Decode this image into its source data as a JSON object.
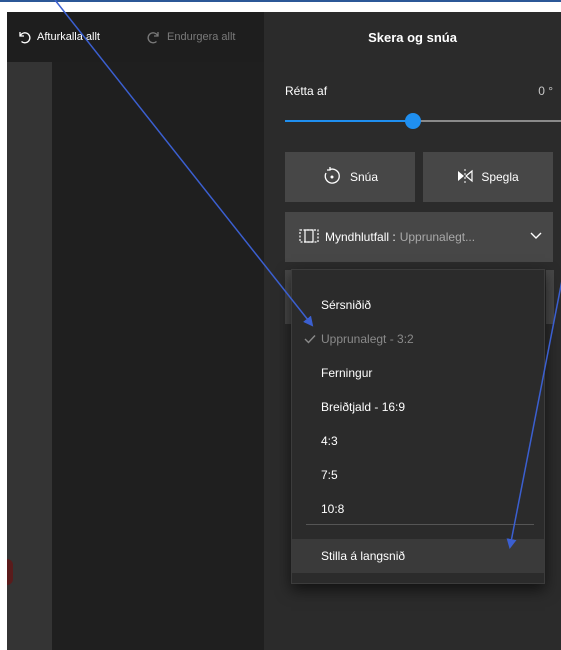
{
  "toolbar": {
    "undo_all_label": "Afturkalla allt",
    "redo_all_label": "Endurgera allt"
  },
  "panel": {
    "title": "Skera og snúa",
    "straighten_label": "Rétta af",
    "straighten_value": "0 °",
    "straighten_level_percent": 46,
    "rotate_label": "Snúa",
    "flip_label": "Spegla",
    "aspect_label": "Myndhlutfall :",
    "aspect_value": "Upprunalegt..."
  },
  "aspect_menu": {
    "items": [
      {
        "label": "Sérsniðið"
      },
      {
        "label": "Upprunalegt - 3:2",
        "selected": true
      },
      {
        "label": "Ferningur"
      },
      {
        "label": "Breiðtjald - 16:9"
      },
      {
        "label": "4:3"
      },
      {
        "label": "7:5"
      },
      {
        "label": "10:8"
      }
    ],
    "landscape_label": "Stilla á langsnið"
  },
  "colors": {
    "accent": "#1f8ff0",
    "annotation_arrow": "#3b5fd0",
    "panel_bg": "#2b2b2b",
    "button_bg": "#474747"
  },
  "icons": [
    "undo-icon",
    "redo-icon",
    "rotate-icon",
    "flip-icon",
    "aspect-ratio-icon",
    "chevron-down-icon",
    "check-icon"
  ]
}
